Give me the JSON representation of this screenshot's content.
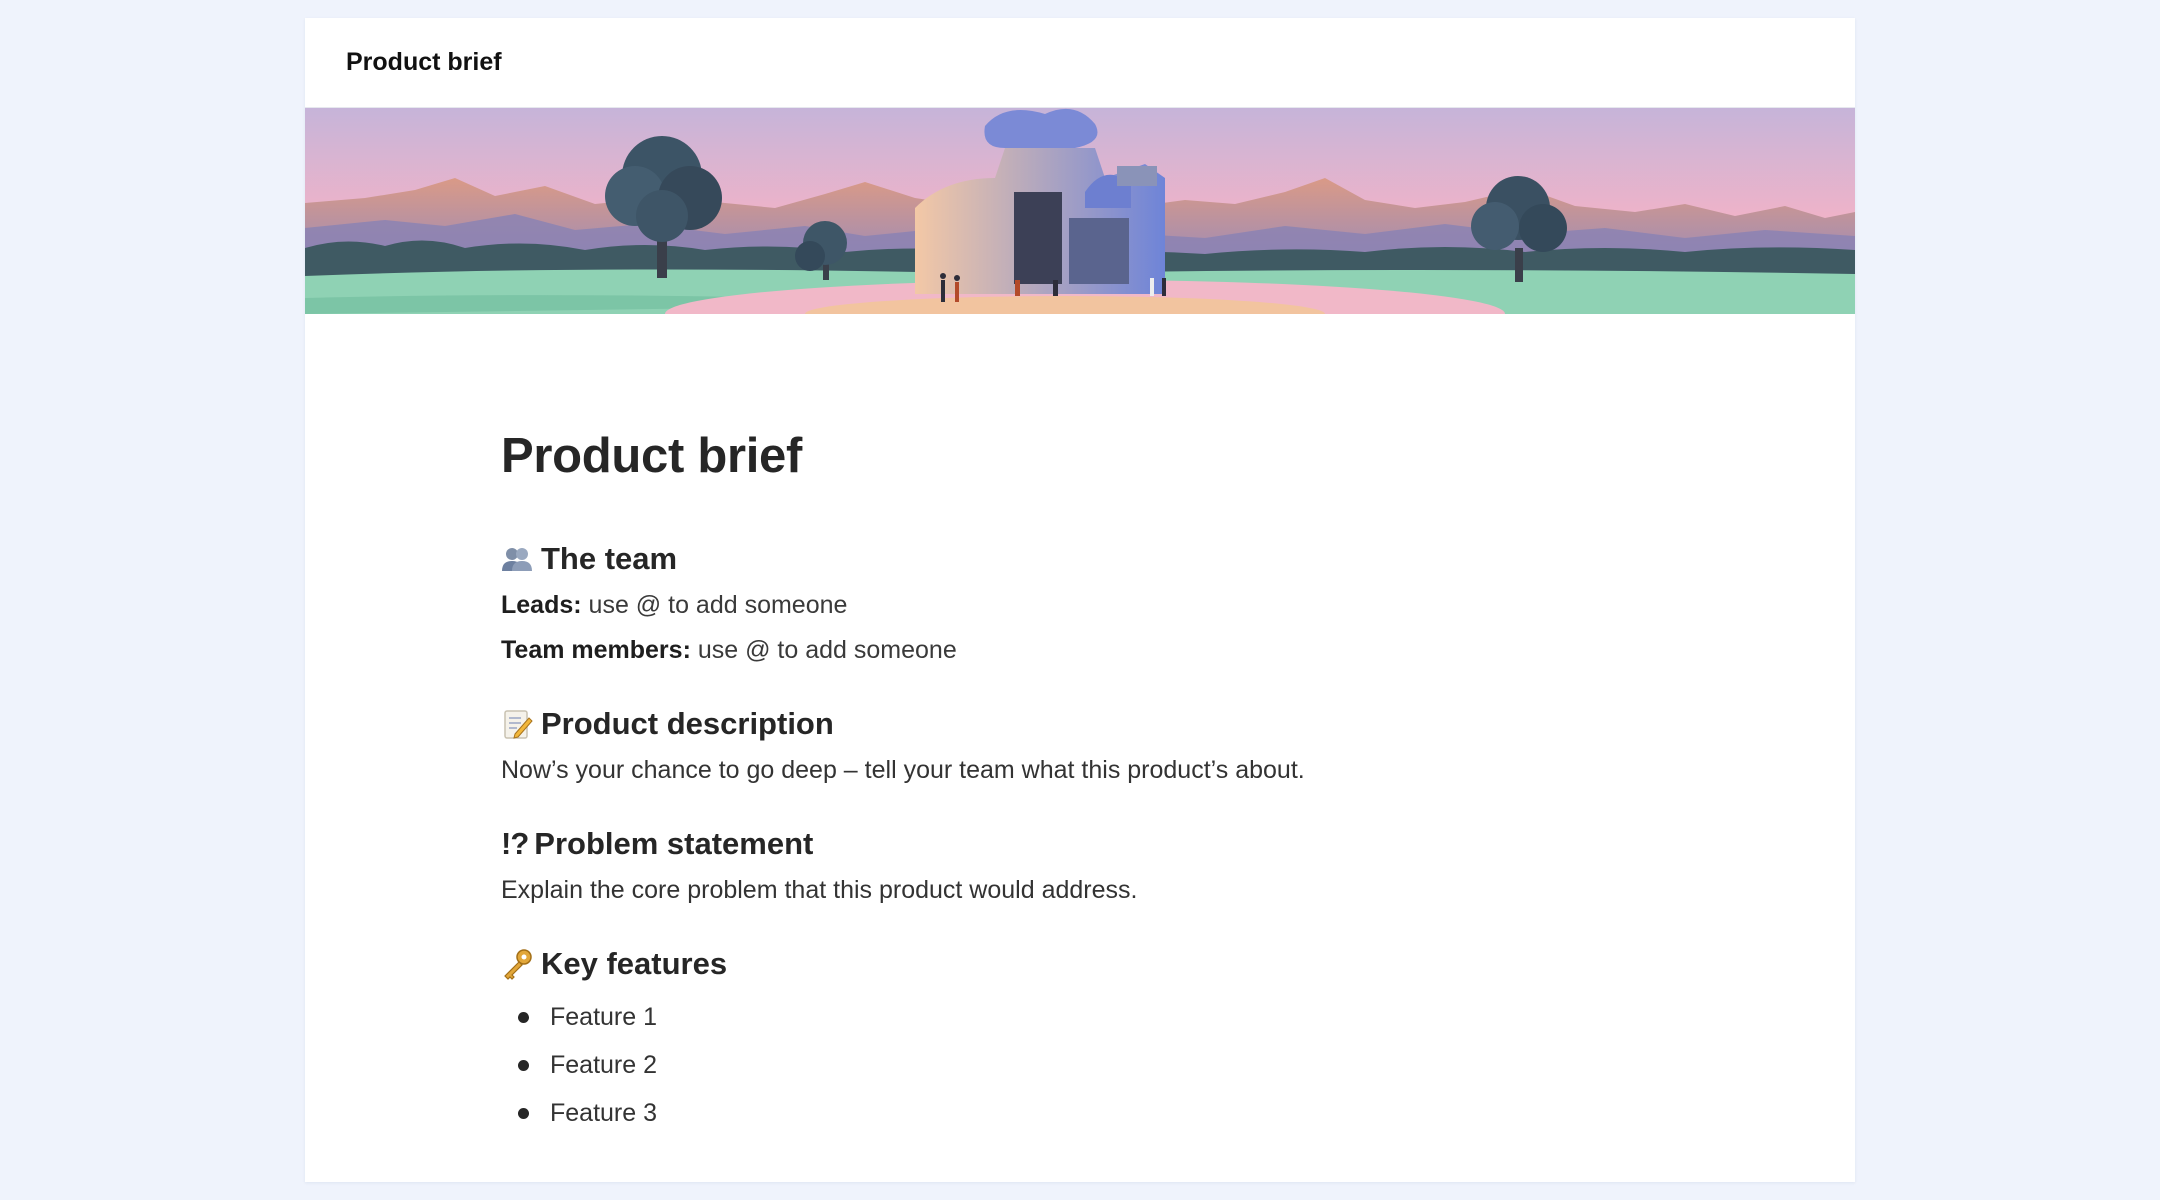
{
  "header": {
    "title": "Product brief"
  },
  "document": {
    "title": "Product brief",
    "team": {
      "heading": "The team",
      "icon": "people-icon",
      "leads_label": "Leads:",
      "leads_value": "use @ to add someone",
      "members_label": "Team members:",
      "members_value": "use @ to add someone"
    },
    "description": {
      "heading": "Product description",
      "icon": "memo-icon",
      "text": "Now’s your chance to go deep – tell your team what this product’s about."
    },
    "problem": {
      "heading": "Problem statement",
      "mark": "!?",
      "text": "Explain the core problem that this product would address."
    },
    "features": {
      "heading": "Key features",
      "icon": "key-icon",
      "items": [
        "Feature 1",
        "Feature 2",
        "Feature 3"
      ]
    }
  },
  "colors": {
    "background": "#eff3fc",
    "page": "#ffffff",
    "text": "#262626",
    "banner_sky_top": "#c8b3d8",
    "banner_sky_bottom": "#f2b2c4",
    "banner_grass": "#8fd2b4",
    "banner_building": "#6f86d9"
  }
}
